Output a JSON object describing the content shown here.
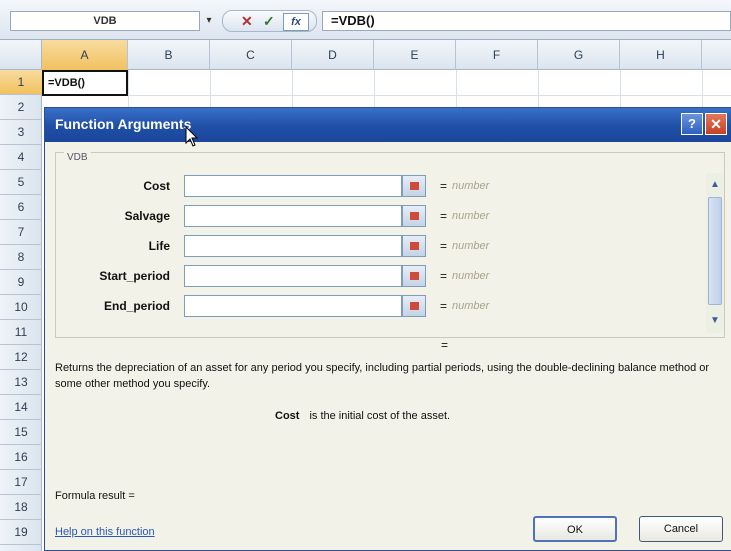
{
  "formula_bar": {
    "name_box": "VDB",
    "dropdown": "▾",
    "cancel_icon": "✕",
    "enter_icon": "✓",
    "fx_label": "fx",
    "formula": "=VDB()"
  },
  "grid": {
    "columns": [
      "A",
      "B",
      "C",
      "D",
      "E",
      "F",
      "G",
      "H"
    ],
    "rows": [
      "1",
      "2",
      "3",
      "4",
      "5",
      "6",
      "7",
      "8",
      "9",
      "10",
      "11",
      "12",
      "13",
      "14",
      "15",
      "16",
      "17",
      "18",
      "19"
    ],
    "active_cell_value": "=VDB()"
  },
  "dialog": {
    "title": "Function Arguments",
    "help_icon": "?",
    "close_icon": "✕",
    "function_name": "VDB",
    "arguments": [
      {
        "label": "Cost",
        "value": "",
        "hint": "number"
      },
      {
        "label": "Salvage",
        "value": "",
        "hint": "number"
      },
      {
        "label": "Life",
        "value": "",
        "hint": "number"
      },
      {
        "label": "Start_period",
        "value": "",
        "hint": "number"
      },
      {
        "label": "End_period",
        "value": "",
        "hint": "number"
      }
    ],
    "equals": "=",
    "description": "Returns the depreciation of an asset for any period you specify, including partial periods, using the double-declining balance method or some other method you specify.",
    "arg_name": "Cost",
    "arg_description": "is the initial cost of the asset.",
    "formula_result_label": "Formula result =",
    "help_link": "Help on this function",
    "ok_label": "OK",
    "cancel_label": "Cancel"
  },
  "colors": {
    "titlebar": "#1f4fa7",
    "dialog_bg": "#f2f2e8",
    "selected_header": "#f1c15e",
    "link": "#2a59b5"
  }
}
